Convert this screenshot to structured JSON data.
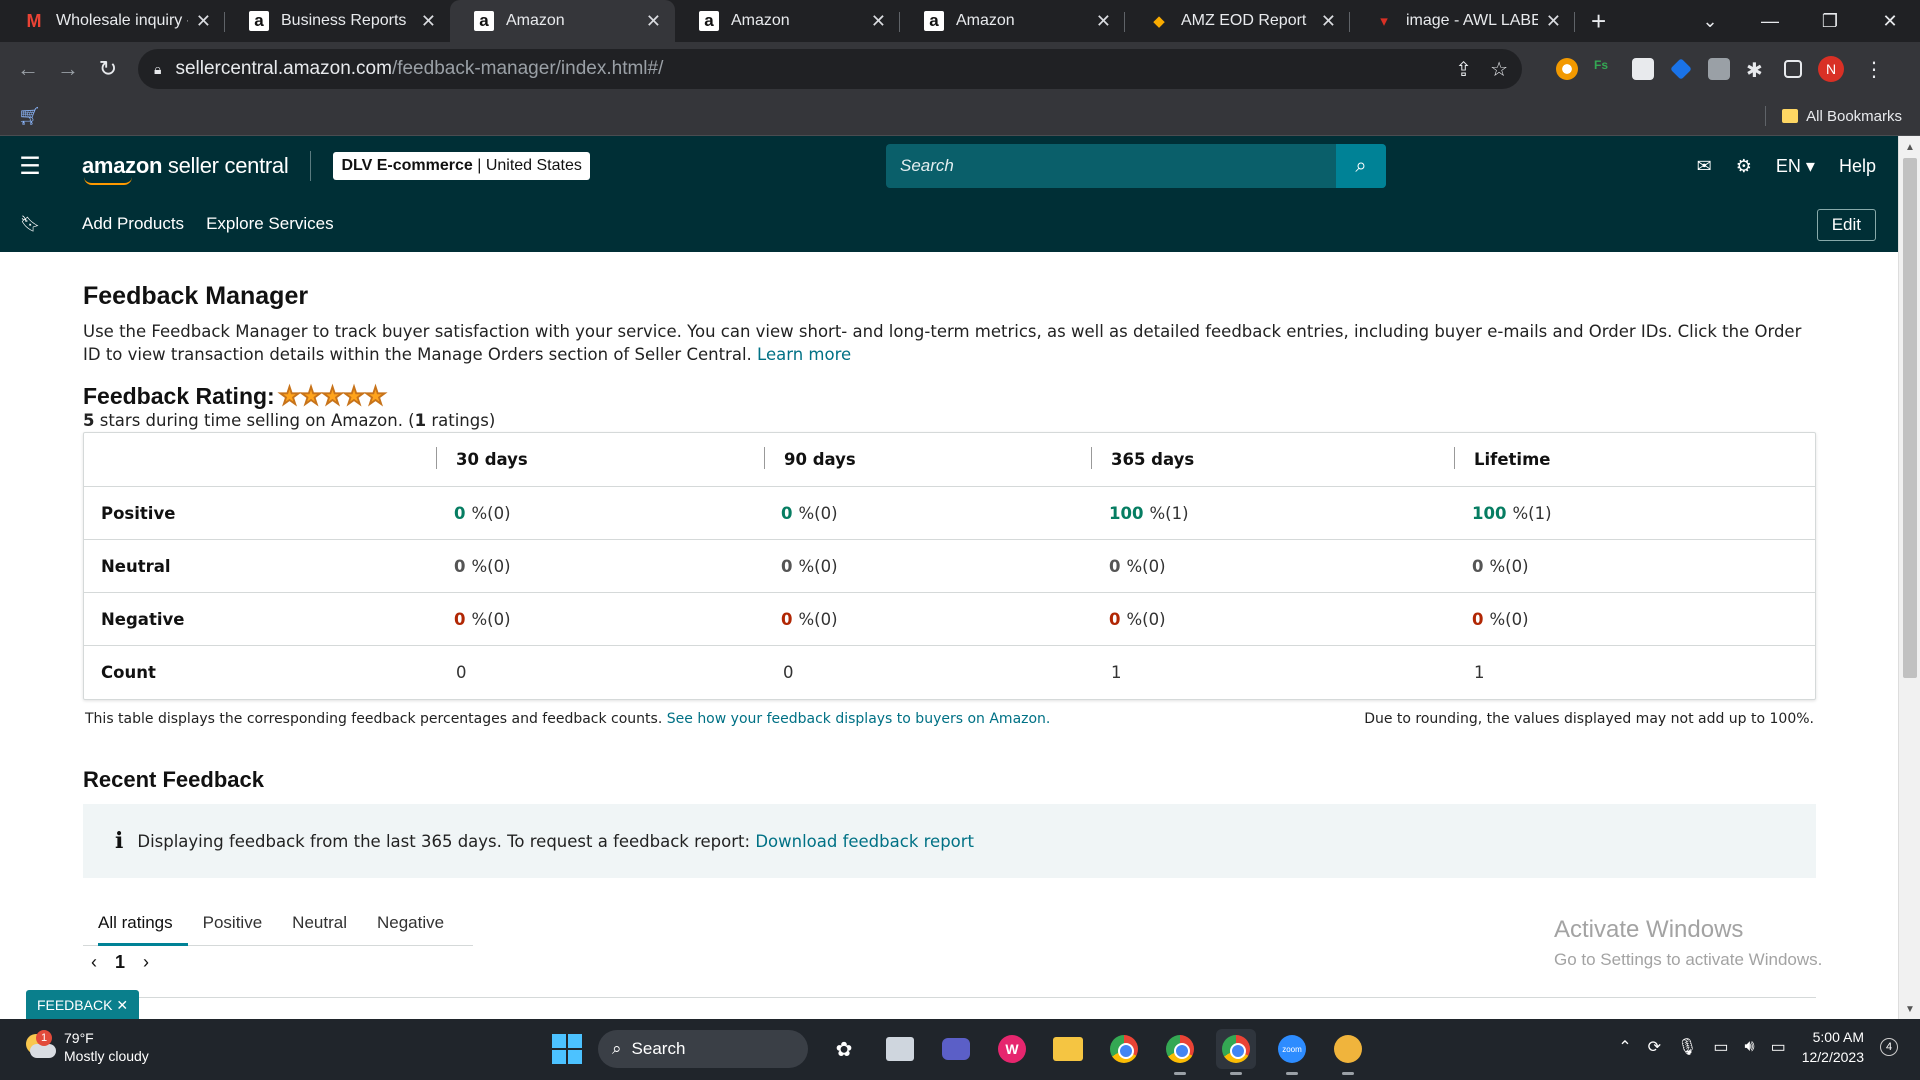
{
  "browser": {
    "tabs": [
      {
        "title": "Wholesale inquiry - d",
        "favicon": "gmail-icon",
        "active": false
      },
      {
        "title": "Business Reports",
        "favicon": "amazon-icon",
        "active": false
      },
      {
        "title": "Amazon",
        "favicon": "amazon-icon",
        "active": true
      },
      {
        "title": "Amazon",
        "favicon": "amazon-icon",
        "active": false
      },
      {
        "title": "Amazon",
        "favicon": "amazon-icon",
        "active": false
      },
      {
        "title": "AMZ EOD Report",
        "favicon": "report-icon",
        "active": false
      },
      {
        "title": "image - AWL LABEL",
        "favicon": "awl-icon",
        "active": false
      }
    ],
    "url_host": "sellercentral.amazon.com",
    "url_path": "/feedback-manager/index.html#/",
    "profile_initial": "N",
    "bookmarks_label": "All Bookmarks"
  },
  "header": {
    "logo_bold": "amazon",
    "logo_rest": " seller central",
    "account_name": "DLV E-commerce",
    "account_region": "United States",
    "search_placeholder": "Search",
    "language": "EN",
    "help": "Help"
  },
  "nav": {
    "items": [
      "Add Products",
      "Explore Services"
    ],
    "edit": "Edit"
  },
  "page": {
    "title": "Feedback Manager",
    "intro": "Use the Feedback Manager to track buyer satisfaction with your service. You can view short- and long-term metrics, as well as detailed feedback entries, including buyer e-mails and Order IDs. Click the Order ID to view transaction details within the Manage Orders section of Seller Central.",
    "learn_more": "Learn more",
    "rating_label": "Feedback Rating:",
    "rating_stars": 5,
    "rating_sub_prefix": "5",
    "rating_sub_middle": " stars during time selling on Amazon. (",
    "rating_sub_count": "1",
    "rating_sub_suffix": " ratings)"
  },
  "feedback_table": {
    "columns": [
      "30 days",
      "90 days",
      "365 days",
      "Lifetime"
    ],
    "rows": [
      {
        "label": "Positive",
        "values": [
          {
            "pct": "0",
            "n": "%(0)"
          },
          {
            "pct": "0",
            "n": "%(0)"
          },
          {
            "pct": "100",
            "n": "%(1)"
          },
          {
            "pct": "100",
            "n": "%(1)"
          }
        ]
      },
      {
        "label": "Neutral",
        "values": [
          {
            "pct": "0",
            "n": "%(0)"
          },
          {
            "pct": "0",
            "n": "%(0)"
          },
          {
            "pct": "0",
            "n": "%(0)"
          },
          {
            "pct": "0",
            "n": "%(0)"
          }
        ]
      },
      {
        "label": "Negative",
        "values": [
          {
            "pct": "0",
            "n": "%(0)"
          },
          {
            "pct": "0",
            "n": "%(0)"
          },
          {
            "pct": "0",
            "n": "%(0)"
          },
          {
            "pct": "0",
            "n": "%(0)"
          }
        ]
      },
      {
        "label": "Count",
        "values": [
          "0",
          "0",
          "1",
          "1"
        ]
      }
    ],
    "note": "This table displays the corresponding feedback percentages and feedback counts.",
    "note_link": "See how your feedback displays to buyers on Amazon.",
    "rounding_note": "Due to rounding, the values displayed may not add up to 100%."
  },
  "recent": {
    "title": "Recent Feedback",
    "info_text": "Displaying feedback from the last 365 days. To request a feedback report:",
    "info_link": "Download feedback report",
    "tabs": [
      "All ratings",
      "Positive",
      "Neutral",
      "Negative"
    ],
    "page": "1"
  },
  "feedback_button": "FEEDBACK",
  "watermark": {
    "line1": "Activate Windows",
    "line2": "Go to Settings to activate Windows."
  },
  "taskbar": {
    "temperature": "79°F",
    "weather": "Mostly cloudy",
    "weather_badge": "1",
    "search": "Search",
    "time": "5:00 AM",
    "date": "12/2/2023",
    "notifications": "4"
  },
  "colors": {
    "header_bg": "#002f36",
    "search_btn": "#008296",
    "positive": "#067d62",
    "negative": "#b12704",
    "link": "#007185",
    "star": "#ffa41c"
  }
}
